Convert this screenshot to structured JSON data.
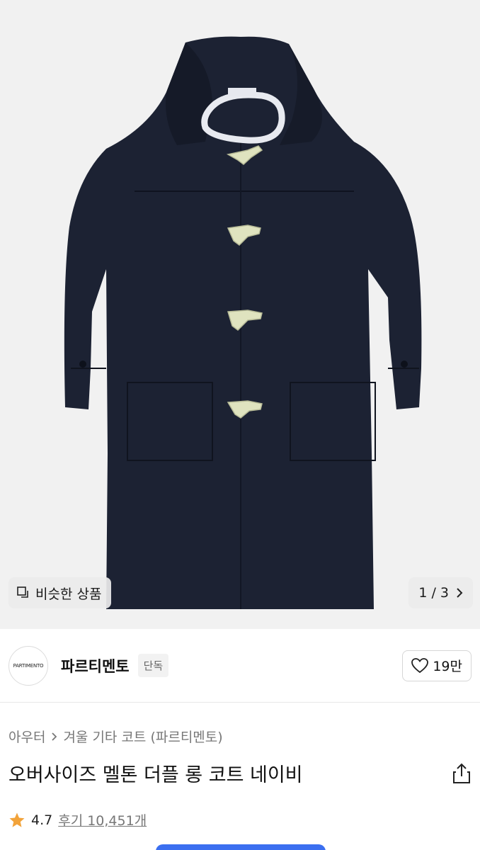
{
  "hero": {
    "similar_label": "비슷한 상품",
    "pager_text": "1 / 3",
    "similar_icon": "copy-icon",
    "next_icon": "chevron-right-icon"
  },
  "brand": {
    "logo_text": "PARTIMENTO",
    "name": "파르티멘토",
    "tag": "단독",
    "like_count": "19만",
    "like_icon": "heart-icon"
  },
  "product": {
    "breadcrumb": [
      "아우터",
      "겨울 기타 코트 (파르티멘토)"
    ],
    "title": "오버사이즈 멜톤 더플 롱 코트 네이비",
    "share_icon": "share-icon",
    "rating": "4.7",
    "review_text": "후기 10,451개",
    "star_icon": "star-icon"
  },
  "colors": {
    "hero_bg": "#f1f1f1",
    "coat": "#1c2233",
    "toggle": "#dfe3bf",
    "star": "#f2a33a"
  }
}
